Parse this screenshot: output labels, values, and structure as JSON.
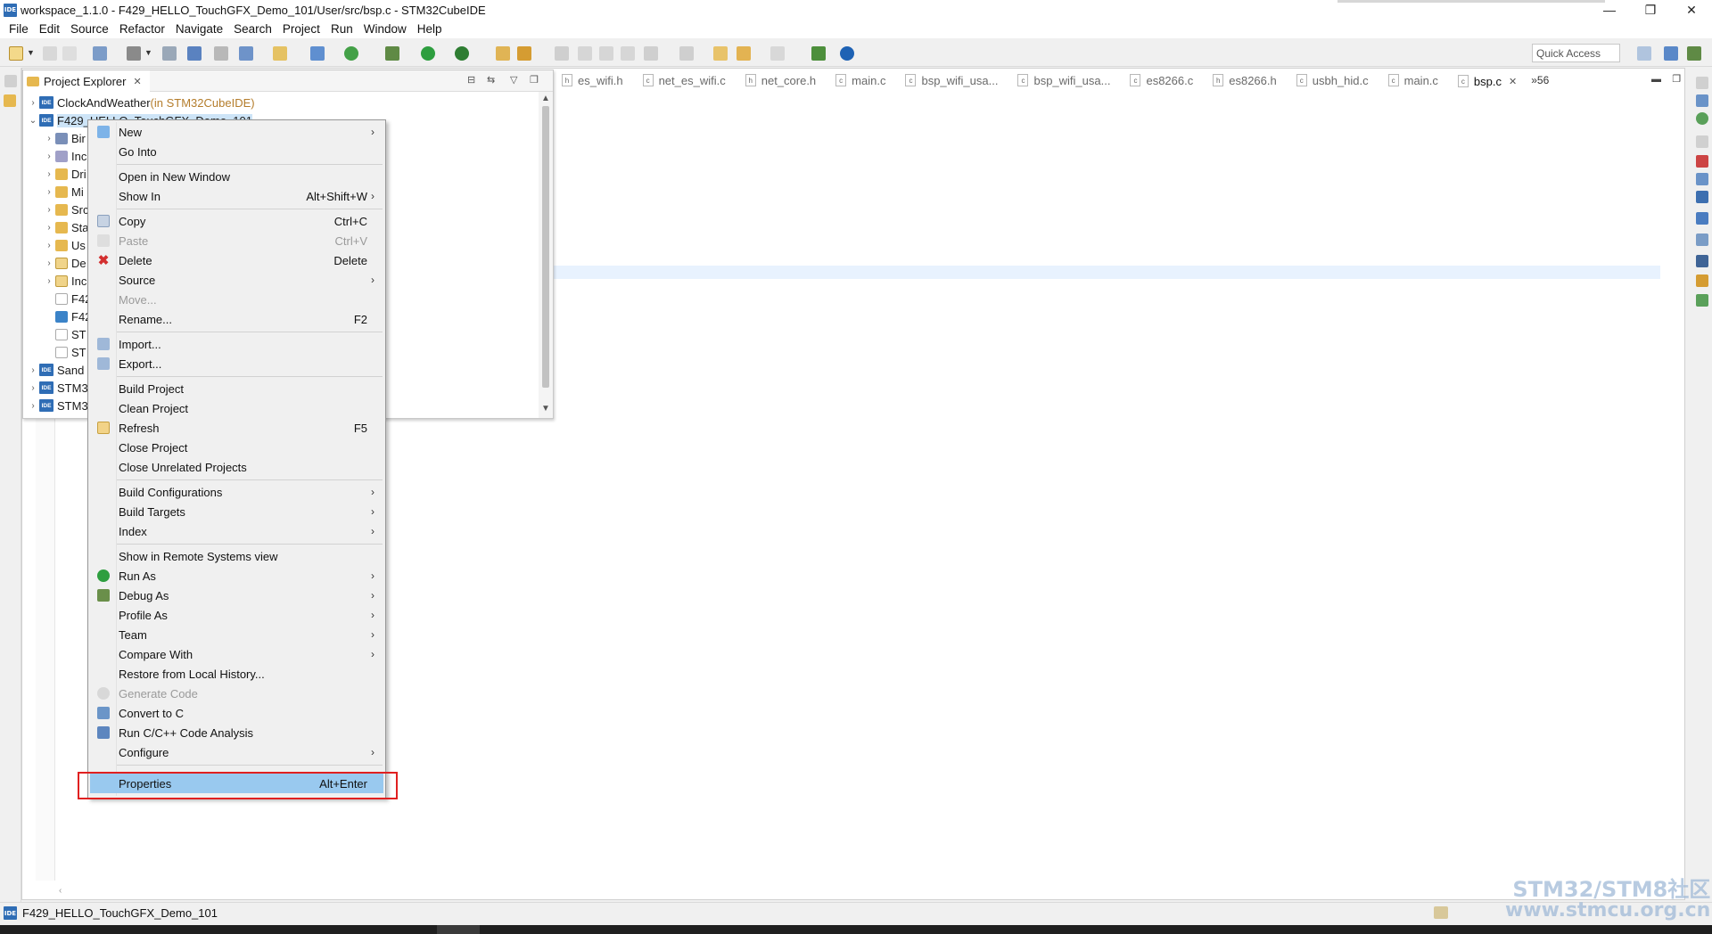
{
  "window": {
    "title": "workspace_1.1.0 - F429_HELLO_TouchGFX_Demo_101/User/src/bsp.c - STM32CubeIDE",
    "app_badge": "IDE",
    "controls": {
      "minimize": "—",
      "maximize": "❐",
      "close": "✕"
    }
  },
  "menubar": {
    "items": [
      {
        "label": "File"
      },
      {
        "label": "Edit"
      },
      {
        "label": "Source"
      },
      {
        "label": "Refactor"
      },
      {
        "label": "Navigate"
      },
      {
        "label": "Search"
      },
      {
        "label": "Project"
      },
      {
        "label": "Run"
      },
      {
        "label": "Window"
      },
      {
        "label": "Help"
      }
    ]
  },
  "toolbar": {
    "quick_access_placeholder": "Quick Access",
    "info_icon": "info-icon"
  },
  "explorer": {
    "tab_label": "Project Explorer",
    "close": "✕",
    "tree": [
      {
        "name": "ClockAndWeather",
        "suffix": " (in STM32CubeIDE)",
        "chev": "›"
      },
      {
        "name": "F429_HELLO_TouchGFX_Demo_101",
        "chev": "⌄"
      },
      {
        "name": "Bir"
      },
      {
        "name": "Inc"
      },
      {
        "name": "Dri"
      },
      {
        "name": "Mi"
      },
      {
        "name": "Src"
      },
      {
        "name": "Sta"
      },
      {
        "name": "Us"
      },
      {
        "name": "De"
      },
      {
        "name": "Inc"
      },
      {
        "name": "F42"
      },
      {
        "name": "F42"
      },
      {
        "name": "ST"
      },
      {
        "name": "ST"
      },
      {
        "name": "Sand"
      },
      {
        "name": "STM3"
      },
      {
        "name": "STM3"
      }
    ]
  },
  "editor": {
    "tabs": [
      {
        "label": "es_wifi.h"
      },
      {
        "label": "net_es_wifi.c"
      },
      {
        "label": "net_core.h"
      },
      {
        "label": "main.c"
      },
      {
        "label": "bsp_wifi_usa..."
      },
      {
        "label": "bsp_wifi_usa..."
      },
      {
        "label": "es8266.c"
      },
      {
        "label": "es8266.h"
      },
      {
        "label": "usbh_hid.c"
      },
      {
        "label": "main.c"
      },
      {
        "label": "bsp.c"
      }
    ],
    "overflow_count": "»56",
    "scroll_left_arrow": "‹"
  },
  "context_menu": {
    "items": [
      {
        "label": "New",
        "accel": "",
        "submenu": true
      },
      {
        "label": "Go Into",
        "accel": ""
      },
      {
        "label": "Open in New Window",
        "accel": ""
      },
      {
        "label": "Show In",
        "accel": "Alt+Shift+W",
        "submenu": true
      },
      {
        "label": "Copy",
        "accel": "Ctrl+C",
        "icon": "copy-icon"
      },
      {
        "label": "Paste",
        "accel": "Ctrl+V",
        "icon": "paste-icon",
        "disabled": true
      },
      {
        "label": "Delete",
        "accel": "Delete",
        "icon": "delete-icon"
      },
      {
        "label": "Source",
        "accel": "",
        "submenu": true
      },
      {
        "label": "Move...",
        "accel": "",
        "disabled": true
      },
      {
        "label": "Rename...",
        "accel": "F2"
      },
      {
        "label": "Import...",
        "accel": "",
        "icon": "import-icon"
      },
      {
        "label": "Export...",
        "accel": "",
        "icon": "export-icon"
      },
      {
        "label": "Build Project",
        "accel": ""
      },
      {
        "label": "Clean Project",
        "accel": ""
      },
      {
        "label": "Refresh",
        "accel": "F5",
        "icon": "refresh-icon"
      },
      {
        "label": "Close Project",
        "accel": ""
      },
      {
        "label": "Close Unrelated Projects",
        "accel": ""
      },
      {
        "label": "Build Configurations",
        "accel": "",
        "submenu": true
      },
      {
        "label": "Build Targets",
        "accel": "",
        "submenu": true
      },
      {
        "label": "Index",
        "accel": "",
        "submenu": true
      },
      {
        "label": "Show in Remote Systems view",
        "accel": ""
      },
      {
        "label": "Run As",
        "accel": "",
        "submenu": true,
        "icon": "run-icon"
      },
      {
        "label": "Debug As",
        "accel": "",
        "submenu": true,
        "icon": "debug-icon"
      },
      {
        "label": "Profile As",
        "accel": "",
        "submenu": true
      },
      {
        "label": "Team",
        "accel": "",
        "submenu": true
      },
      {
        "label": "Compare With",
        "accel": "",
        "submenu": true
      },
      {
        "label": "Restore from Local History...",
        "accel": ""
      },
      {
        "label": "Generate Code",
        "accel": "",
        "disabled": true,
        "icon": "generate-code-icon"
      },
      {
        "label": "Convert to C",
        "accel": "",
        "icon": "convert-c-icon"
      },
      {
        "label": "Run C/C++ Code Analysis",
        "accel": "",
        "icon": "code-analysis-icon"
      },
      {
        "label": "Configure",
        "accel": "",
        "submenu": true
      },
      {
        "label": "Properties",
        "accel": "Alt+Enter",
        "selected": true
      }
    ],
    "submenu_arrow": "›"
  },
  "statusbar": {
    "text": "F429_HELLO_TouchGFX_Demo_101"
  },
  "watermark": {
    "line1": "STM32/STM8社区",
    "line2": "www.stmcu.org.cn"
  },
  "colors": {
    "ide_blue": "#2f6db5",
    "selection": "#99c9ef",
    "highlight_box": "#e02020",
    "line_highlight": "#e8f2fe"
  }
}
